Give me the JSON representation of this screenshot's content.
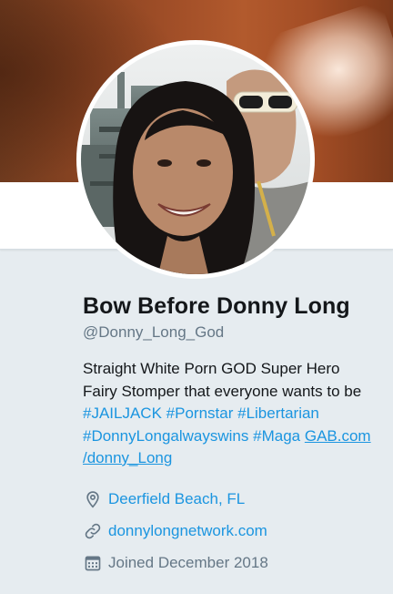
{
  "colors": {
    "accent": "#1b95e0",
    "secondary_text": "#657786",
    "primary_text": "#14171a",
    "page_bg": "#e6ecf0"
  },
  "profile": {
    "display_name": "Bow Before Donny Long",
    "handle": "@Donny_Long_God",
    "bio": {
      "line1": "Straight White Porn GOD Super Hero",
      "line2": "Fairy Stomper that everyone wants to be",
      "hashtags": [
        "#JAILJACK",
        "#Pornstar",
        "#Libertarian",
        "#DonnyLongalwayswins",
        "#Maga"
      ],
      "link_part1": "GAB.com",
      "link_part2": "/donny_Long"
    },
    "location": "Deerfield Beach, FL",
    "website": "donnylongnetwork.com",
    "joined": "Joined December 2018"
  },
  "icons": {
    "location": "location-pin-icon",
    "website": "link-icon",
    "joined": "calendar-icon"
  }
}
